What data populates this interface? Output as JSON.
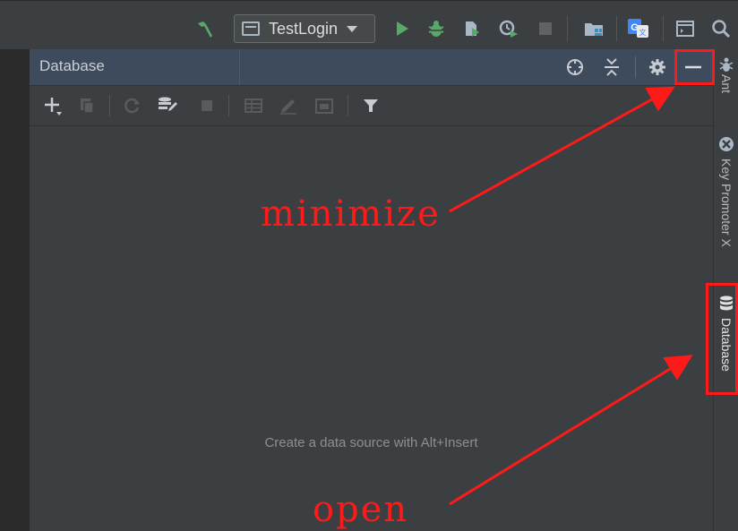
{
  "toolbar": {
    "run_config": "TestLogin"
  },
  "panel": {
    "title": "Database",
    "empty_hint": "Create a data source with Alt+Insert"
  },
  "right_strip": {
    "tabs": [
      {
        "label": "Ant"
      },
      {
        "label": "Key Promoter X"
      },
      {
        "label": "Database"
      }
    ]
  },
  "annotations": {
    "minimize": "minimize",
    "open": "open",
    "color": "#ff1a1a"
  },
  "colors": {
    "header_accent": "#3d4b5c",
    "run_green": "#59a869"
  }
}
